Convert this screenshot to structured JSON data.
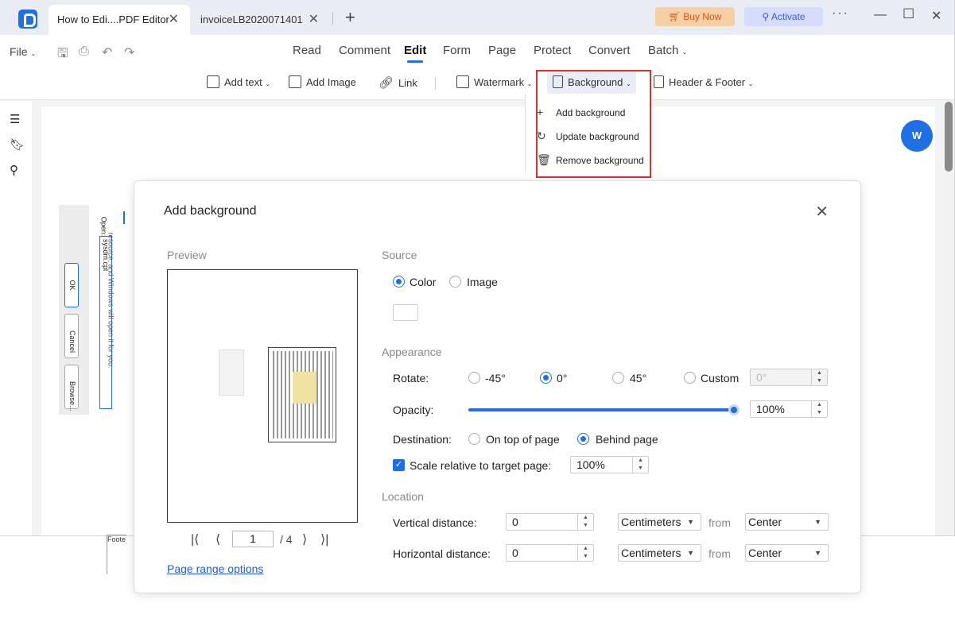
{
  "tabs": [
    {
      "label": "How to Edi....PDF Editor"
    },
    {
      "label": "invoiceLB2020071401"
    }
  ],
  "titlebar": {
    "buy_now": "Buy Now",
    "activate": "Activate"
  },
  "menu": {
    "file": "File",
    "items": [
      "Read",
      "Comment",
      "Edit",
      "Form",
      "Page",
      "Protect",
      "Convert",
      "Batch"
    ]
  },
  "toolbar": {
    "add_text": "Add text",
    "add_image": "Add Image",
    "link": "Link",
    "watermark": "Watermark",
    "background": "Background",
    "header_footer": "Header & Footer"
  },
  "dropdown": {
    "items": [
      "Add background",
      "Update background",
      "Remove background"
    ]
  },
  "doc_content": {
    "open_label": "Open:",
    "field_value": "sysdm.cpl",
    "ok": "OK",
    "cancel": "Cancel",
    "browse": "Browse...",
    "side_text": "resource, and Windows will open it for you.",
    "footer_fragment": "Foote"
  },
  "word_button": "W",
  "dialog": {
    "title": "Add background",
    "preview_label": "Preview",
    "source_label": "Source",
    "source_options": [
      "Color",
      "Image"
    ],
    "appearance_label": "Appearance",
    "rotate_label": "Rotate:",
    "rotate_options": [
      "-45°",
      "0°",
      "45°",
      "Custom"
    ],
    "custom_rotate_value": "0°",
    "opacity_label": "Opacity:",
    "opacity_value": "100%",
    "opacity_fraction": 1.0,
    "destination_label": "Destination:",
    "destination_options": [
      "On top of page",
      "Behind page"
    ],
    "scale_label": "Scale relative to target page:",
    "scale_value": "100%",
    "location_label": "Location",
    "vertical_label": "Vertical distance:",
    "vertical_value": "0",
    "vertical_unit": "Centimeters",
    "vertical_from": "from",
    "vertical_anchor": "Center",
    "horizontal_label": "Horizontal distance:",
    "horizontal_value": "0",
    "horizontal_unit": "Centimeters",
    "horizontal_from": "from",
    "horizontal_anchor": "Center",
    "page_current": "1",
    "page_total": "/ 4",
    "page_range_link": "Page range options"
  },
  "colors": {
    "accent": "#1f6fe5",
    "highlight_box": "#e03030"
  }
}
